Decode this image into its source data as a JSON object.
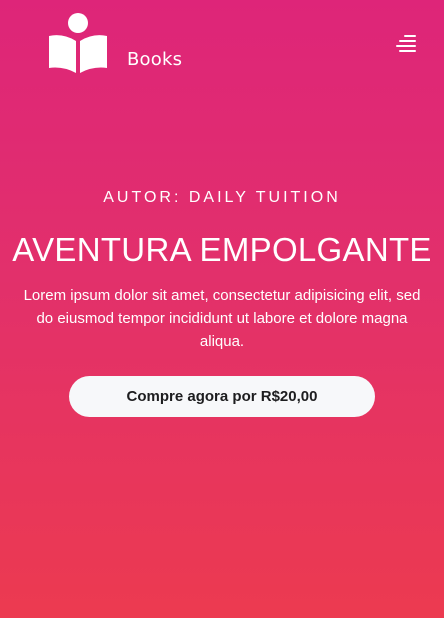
{
  "navbar": {
    "brand_name": "Books",
    "logo_icon": "book-reader-icon",
    "menu_icon": "hamburger-menu-icon"
  },
  "hero": {
    "author_line": "AUTOR: DAILY TUITION",
    "title": "AVENTURA EMPOLGANTE",
    "description": "Lorem ipsum dolor sit amet, consectetur adipisicing elit, sed do eiusmod tempor incididunt ut labore et dolore magna aliqua.",
    "cta_label": "Compre agora por R$20,00"
  },
  "colors": {
    "gradient_top": "#de2579",
    "gradient_bottom": "#ec3a50",
    "text": "#ffffff",
    "button_bg": "#f7f8fa",
    "button_text": "#1d1d1f"
  }
}
